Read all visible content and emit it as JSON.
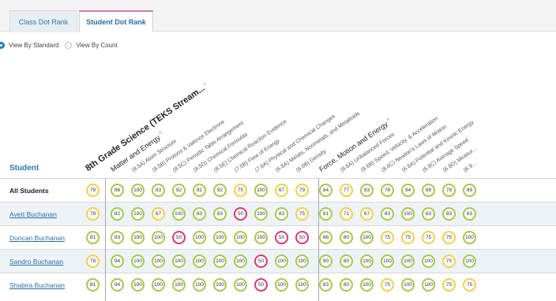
{
  "tabs": [
    {
      "label": "Class Dot Rank",
      "active": false
    },
    {
      "label": "Student Dot Rank",
      "active": true
    }
  ],
  "view_options": [
    {
      "label": "View By Standard",
      "selected": true
    },
    {
      "label": "View By Count",
      "selected": false
    }
  ],
  "colors": {
    "green": "#a6c84b",
    "yellow": "#f2cf4a",
    "red": "#d93a6c",
    "link": "#2a6fa3",
    "tab_accent": "#c97ab8"
  },
  "columns": [
    {
      "label": "8th Grade Science (TEKS Stream...",
      "style": "big",
      "caret": "⌐"
    },
    {
      "label": "Matter and Energy",
      "style": "mid",
      "caret": "^"
    },
    {
      "label": "(8.5A) Atom Structure",
      "style": "small"
    },
    {
      "label": "(8.5B) Protons & Valence Electrons",
      "style": "small"
    },
    {
      "label": "(8.5C) Periodic Table Arrangement",
      "style": "small"
    },
    {
      "label": "(8.5D) Chemical Formulas",
      "style": "small"
    },
    {
      "label": "(8.5E) Chemical Reaction Evidence",
      "style": "small"
    },
    {
      "label": "(7.5B) Flow of Energy",
      "style": "small"
    },
    {
      "label": "(7.6A) Physical and Chemical Changes",
      "style": "small"
    },
    {
      "label": "(6.6A) Metals, Nonmetals, and Metalloids",
      "style": "small"
    },
    {
      "label": "(6.6B) Density",
      "style": "small"
    },
    {
      "label": "Force, Motion and Energy",
      "style": "mid",
      "caret": "^"
    },
    {
      "label": "(8.6A) Unbalanced Forces",
      "style": "small"
    },
    {
      "label": "(8.6B) Speed, Velocity, & Acceleration",
      "style": "small"
    },
    {
      "label": "(8.6C) Newton's Laws of Motion",
      "style": "small"
    },
    {
      "label": "(6.8A) Potential and Kinetic Energy",
      "style": "small"
    },
    {
      "label": "(6.8C) Average Speed",
      "style": "small"
    },
    {
      "label": "(6.8D) Measur...",
      "style": "small"
    },
    {
      "label": "(6.9...",
      "style": "small"
    }
  ],
  "student_header": "Student",
  "rows": [
    {
      "name": "All Students",
      "link": false,
      "alt": false,
      "values": [
        "79",
        "86",
        "100",
        "83",
        "92",
        "92",
        "92",
        "75",
        "100",
        "67",
        "79",
        "84",
        "77",
        "83",
        "78",
        "94",
        "89",
        "78",
        "89"
      ],
      "colors": [
        "y",
        "g",
        "g",
        "g",
        "g",
        "g",
        "g",
        "y",
        "g",
        "y",
        "y",
        "g",
        "y",
        "g",
        "g",
        "g",
        "g",
        "g",
        "g"
      ]
    },
    {
      "name": "Avett Buchanan",
      "link": true,
      "alt": true,
      "values": [
        "78",
        "82",
        "100",
        "67",
        "100",
        "83",
        "83",
        "50",
        "100",
        "83",
        "75",
        "81",
        "71",
        "67",
        "83",
        "100",
        "83",
        "83",
        "83"
      ],
      "colors": [
        "y",
        "g",
        "g",
        "y",
        "g",
        "g",
        "g",
        "r",
        "g",
        "g",
        "y",
        "g",
        "y",
        "y",
        "g",
        "g",
        "g",
        "g",
        "g"
      ]
    },
    {
      "name": "Duncan Buchanan",
      "link": true,
      "alt": false,
      "values": [
        "81",
        "83",
        "100",
        "100",
        "50",
        "100",
        "100",
        "100",
        "100",
        "50",
        "50",
        "88",
        "80",
        "100",
        "75",
        "75",
        "75",
        "75",
        "100"
      ],
      "colors": [
        "g",
        "g",
        "g",
        "g",
        "r",
        "g",
        "g",
        "g",
        "g",
        "r",
        "r",
        "g",
        "g",
        "g",
        "y",
        "y",
        "y",
        "y",
        "g"
      ]
    },
    {
      "name": "Sandro Buchanan",
      "link": true,
      "alt": true,
      "values": [
        "78",
        "94",
        "100",
        "100",
        "100",
        "100",
        "100",
        "100",
        "50",
        "100",
        "100",
        "90",
        "80",
        "100",
        "100",
        "100",
        "100",
        "75",
        "100"
      ],
      "colors": [
        "y",
        "g",
        "g",
        "g",
        "g",
        "g",
        "g",
        "g",
        "r",
        "g",
        "g",
        "g",
        "g",
        "g",
        "g",
        "g",
        "g",
        "y",
        "g"
      ]
    },
    {
      "name": "Shabira Buchanan",
      "link": true,
      "alt": false,
      "values": [
        "81",
        "94",
        "100",
        "100",
        "100",
        "100",
        "100",
        "100",
        "50",
        "100",
        "100",
        "83",
        "80",
        "100",
        "75",
        "100",
        "100",
        "75",
        "75"
      ],
      "colors": [
        "g",
        "g",
        "g",
        "g",
        "g",
        "g",
        "g",
        "g",
        "r",
        "g",
        "g",
        "g",
        "g",
        "g",
        "y",
        "g",
        "g",
        "y",
        "y"
      ]
    }
  ]
}
